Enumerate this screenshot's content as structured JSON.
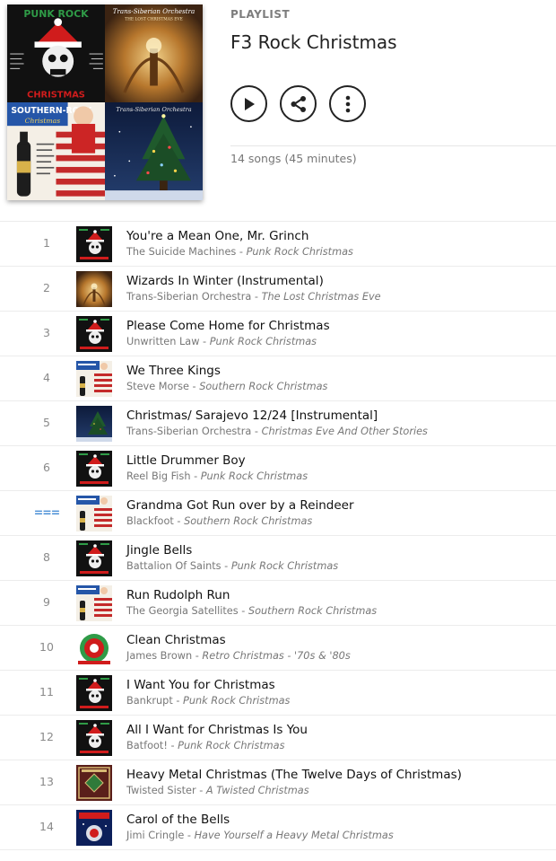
{
  "header": {
    "kicker": "PLAYLIST",
    "title": "F3 Rock Christmas",
    "meta": "14 songs (45 minutes)",
    "cover_labels": {
      "punk_title": "PUNK ROCK",
      "punk_sub": "CHRISTMAS",
      "tso_a": "Trans-Siberian Orchestra",
      "tso_a_sub": "THE LOST CHRISTMAS EVE",
      "southern_title": "SOUTHERN-ROCK",
      "southern_sub": "Christmas",
      "tso_b": "Trans-Siberian Orchestra"
    }
  },
  "actions": {
    "play": "play-icon",
    "share": "share-icon",
    "more": "more-icon"
  },
  "colors": {
    "accent_drag": "#4a8fd6",
    "muted": "#777777",
    "title": "#111111"
  },
  "tracks": [
    {
      "num": "1",
      "title": "You're a Mean One, Mr. Grinch",
      "artist": "The Suicide Machines",
      "album": "Punk Rock Christmas",
      "art": "punk"
    },
    {
      "num": "2",
      "title": "Wizards In Winter (Instrumental)",
      "artist": "Trans-Siberian Orchestra",
      "album": "The Lost Christmas Eve",
      "art": "tso-lost"
    },
    {
      "num": "3",
      "title": "Please Come Home for Christmas",
      "artist": "Unwritten Law",
      "album": "Punk Rock Christmas",
      "art": "punk"
    },
    {
      "num": "4",
      "title": "We Three Kings",
      "artist": "Steve Morse",
      "album": "Southern Rock Christmas",
      "art": "southern"
    },
    {
      "num": "5",
      "title": "Christmas/ Sarajevo 12/24 [Instrumental]",
      "artist": "Trans-Siberian Orchestra",
      "album": "Christmas Eve And Other Stories",
      "art": "tso-eve"
    },
    {
      "num": "6",
      "title": "Little Drummer Boy",
      "artist": "Reel Big Fish",
      "album": "Punk Rock Christmas",
      "art": "punk"
    },
    {
      "num": "===",
      "title": "Grandma Got Run over by a Reindeer",
      "artist": "Blackfoot",
      "album": "Southern Rock Christmas",
      "art": "southern"
    },
    {
      "num": "8",
      "title": "Jingle Bells",
      "artist": "Battalion Of Saints",
      "album": "Punk Rock Christmas",
      "art": "punk"
    },
    {
      "num": "9",
      "title": "Run Rudolph Run",
      "artist": "The Georgia Satellites",
      "album": "Southern Rock Christmas",
      "art": "southern"
    },
    {
      "num": "10",
      "title": "Clean Christmas",
      "artist": "James Brown",
      "album": "Retro Christmas - '70s & '80s",
      "art": "retro"
    },
    {
      "num": "11",
      "title": "I Want You for Christmas",
      "artist": "Bankrupt",
      "album": "Punk Rock Christmas",
      "art": "punk"
    },
    {
      "num": "12",
      "title": "All I Want for Christmas Is You",
      "artist": "Batfoot!",
      "album": "Punk Rock Christmas",
      "art": "punk"
    },
    {
      "num": "13",
      "title": "Heavy Metal Christmas (The Twelve Days of Christmas)",
      "artist": "Twisted Sister",
      "album": "A Twisted Christmas",
      "art": "twisted"
    },
    {
      "num": "14",
      "title": "Carol of the Bells",
      "artist": "Jimi Cringle",
      "album": "Have Yourself a Heavy Metal Christmas",
      "art": "heavymetal"
    }
  ]
}
